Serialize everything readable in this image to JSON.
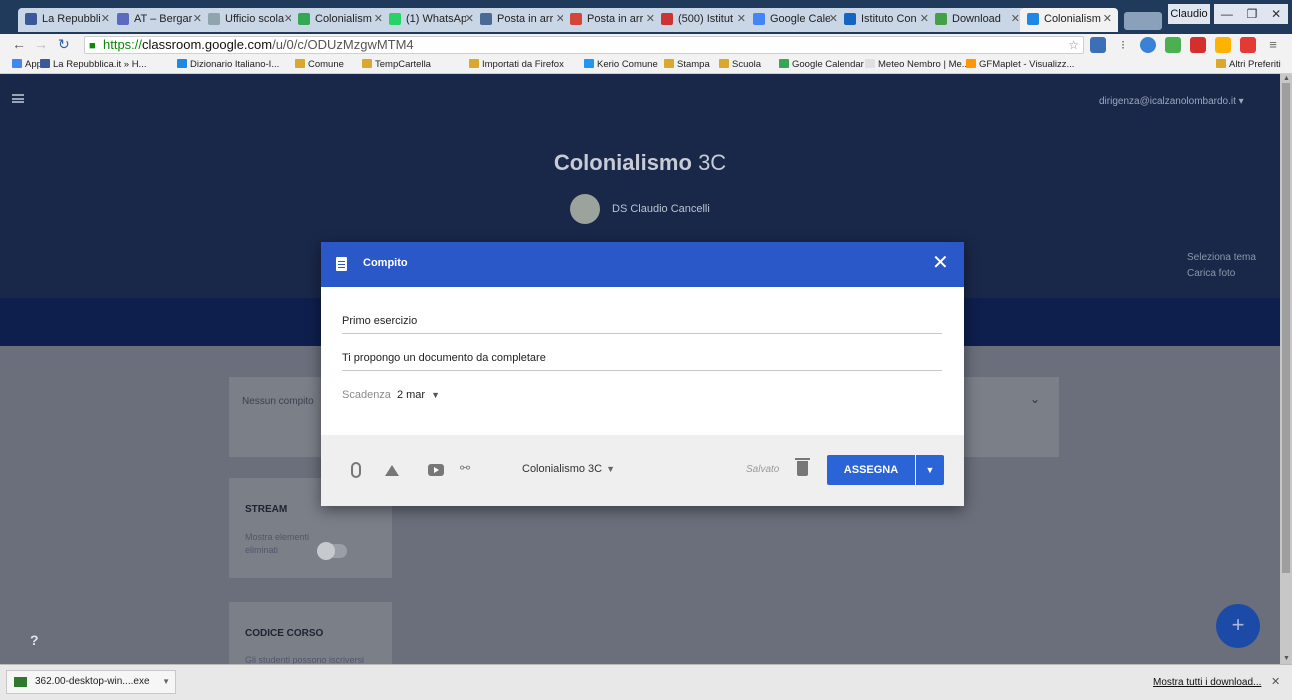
{
  "browser": {
    "tabs": [
      {
        "label": "La Repubbli",
        "color": "#3b5998"
      },
      {
        "label": "AT – Bergar",
        "color": "#5c6bc0"
      },
      {
        "label": "Ufficio scola",
        "color": "#90a4ae"
      },
      {
        "label": "Colonialism",
        "color": "#34a853"
      },
      {
        "label": "(1) WhatsAp",
        "color": "#25d366"
      },
      {
        "label": "Posta in arr",
        "color": "#4a6a96"
      },
      {
        "label": "Posta in arr",
        "color": "#d44638"
      },
      {
        "label": "(500) Istitut",
        "color": "#cc3333"
      },
      {
        "label": "Google Cale",
        "color": "#4285f4"
      },
      {
        "label": "Istituto Con",
        "color": "#1565c0"
      },
      {
        "label": "Download",
        "color": "#43a047"
      },
      {
        "label": "Colonialism",
        "color": "#1e88e5"
      }
    ],
    "user": "Claudio",
    "url": {
      "scheme": "https://",
      "host": "classroom.google.com",
      "path": "/u/0/c/ODUzMzgwMTM4"
    },
    "bookmarks": [
      {
        "label": "App",
        "color": "#4285f4"
      },
      {
        "label": "La Repubblica.it » H...",
        "color": "#3b5998"
      },
      {
        "label": "Dizionario Italiano-I...",
        "color": "#1e88e5"
      },
      {
        "label": "Comune",
        "color": "#d9a92e"
      },
      {
        "label": "TempCartella",
        "color": "#d9a92e"
      },
      {
        "label": "Importati da Firefox",
        "color": "#d9a92e"
      },
      {
        "label": "Kerio Comune",
        "color": "#2196f3"
      },
      {
        "label": "Stampa",
        "color": "#d9a92e"
      },
      {
        "label": "Scuola",
        "color": "#d9a92e"
      },
      {
        "label": "Google Calendar",
        "color": "#34a853"
      },
      {
        "label": "Meteo Nembro | Me...",
        "color": "#e0e0e0"
      },
      {
        "label": "GFMaplet - Visualizz...",
        "color": "#ff9800"
      },
      {
        "label": "Altri Preferiti",
        "color": "#d9a92e"
      }
    ]
  },
  "page": {
    "user_email": "dirigenza@icalzanolombardo.it",
    "class_name_bold": "Colonialismo",
    "class_section": "3C",
    "teacher": "DS Claudio Cancelli",
    "theme_select": "Seleziona tema",
    "upload_photo": "Carica foto",
    "no_assignment": "Nessun compito",
    "stream_title": "STREAM",
    "stream_toggle_label": "Mostra elementi eliminati",
    "course_code_title": "CODICE CORSO",
    "course_code_text": "Gli studenti possono iscriversi",
    "help": "?",
    "fab": "+"
  },
  "modal": {
    "title": "Compito",
    "close": "✕",
    "assignment_title": "Primo esercizio",
    "instructions": "Ti propongo un documento da completare",
    "due_label": "Scadenza",
    "due_date": "2 mar",
    "class_select": "Colonialismo 3C",
    "status": "Salvato",
    "assign_label": "ASSEGNA"
  },
  "downloads": {
    "item": "362.00-desktop-win....exe",
    "show_all": "Mostra tutti i download..."
  }
}
